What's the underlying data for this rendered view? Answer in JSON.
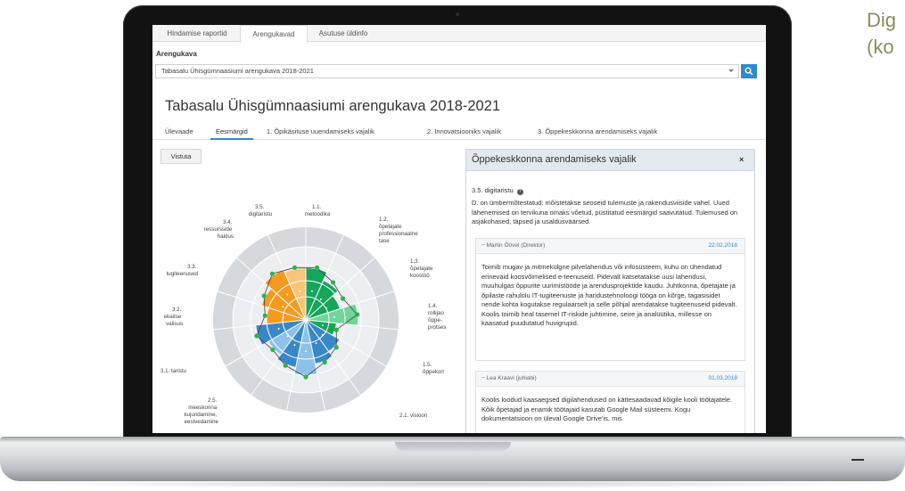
{
  "side_note": {
    "line1": "Dig",
    "line2": "(ko"
  },
  "app": {
    "top_tabs": [
      "Hindamise raportid",
      "Arengukavad",
      "Asutuse üldinfo"
    ],
    "active_top_tab": 1,
    "selector": {
      "label": "Arengukava",
      "value": "Tabasalu Ühisgümnaasiumi arengukava 2018-2021"
    },
    "page_title": "Tabasalu Ühisgümnaasiumi arengukava 2018-2021",
    "sub_tabs": [
      "Ülevaade",
      "Eesmärgid",
      "1. Õpikäsituse uuendamiseks vajalik",
      "2. Innovatsiooniks vajalik",
      "3. Õppekeskkonna arendamiseks vajalik"
    ],
    "active_sub_tab": 1,
    "hide_button": "Vistuta"
  },
  "radar": {
    "labels": {
      "l35": [
        "3.5.",
        "digitaristu"
      ],
      "l11": [
        "1.1.",
        "metoodika"
      ],
      "l34": [
        "3.4.",
        "ressursside",
        "haldus"
      ],
      "l12": [
        "1.2.",
        "õpetajate",
        "professionaalne",
        "tase"
      ],
      "l13": [
        "1.3.",
        "õpetajate",
        "koostöö"
      ],
      "l33": [
        "3.3.",
        "tugiteenused"
      ],
      "l14": [
        "1.4.",
        "rollijao",
        "õppe-",
        "protses"
      ],
      "l32": [
        "3.2.",
        "ekaitse",
        "valisus"
      ],
      "l15": [
        "1.5.",
        "õppekorr"
      ],
      "l31": [
        "3.1. taristu"
      ],
      "l25": [
        "2.5.",
        "meeskonna",
        "kujundamine,",
        "eestvedamine"
      ],
      "l21": [
        "2.1. visioon"
      ]
    },
    "colors": {
      "orange": "#f39a1f",
      "orange_light": "#f8c47a",
      "green": "#17a55a",
      "green_light": "#6fd59a",
      "blue": "#3a87c8",
      "blue_light": "#8cc2ea",
      "ring": "#d5d8dd",
      "point": "#2db24a"
    }
  },
  "panel": {
    "title": "Õppekeskkonna arendamiseks vajalik",
    "close": "×",
    "goal_id": "3.5. digitaristu",
    "goal_desc": "D. on ümbermõtestatud: mõistetakse seoseid tulemuste ja rakendusviiside vahel. Uued lähenemised on tervikuna omaks võetud, püstitatud eesmärgid saavutatud. Tulemused on asjakohased, täpsed ja usaldusväärsed.",
    "comments": [
      {
        "author": "Martin Öövel (Direktor)",
        "date": "22.02.2018",
        "body": "Toimib mugav ja mitmekülgne pilvelahendus või infosüsteem, kuhu on ühendatud erinevaid koosvõimelised e-teenuseid. Pidevalt katsetatakse uusi lahendusi, muuhulgas õppurite uurimistööde ja arendusprojektide kaudu. Juhtkonna, õpetajate ja õpilaste rahulolu IT-tugiteenuste ja haridustehnoloogi tööga on kõrge, tagasisidet nende kohta kogutakse regulaarselt ja selle põhjal arendatakse tugiteenuseid pidevalt. Koolis toimib heal tasemel IT-riskide juhtimine, seire ja analüütika, millesse on kaasatud puudutatud huvigrupid."
      },
      {
        "author": "Lea Kraavi (juhiabi)",
        "date": "01.03.2018",
        "body": "Koolis loodud kaasaegsed digilahendused on kättesaadavad kõigile kooli töötajatele. Kõik õpetajad ja enamik töötajaid kasutab Google Mail süsteemi. Kogu dokumentatsioon on üleval Google Drive'is, mis"
      }
    ]
  }
}
